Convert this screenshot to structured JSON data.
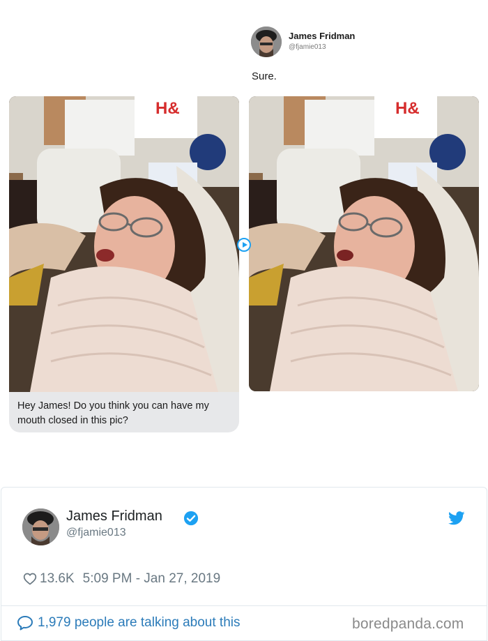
{
  "reply": {
    "name": "James Fridman",
    "handle": "@fjamie013",
    "text": "Sure."
  },
  "dm": {
    "text": "Hey James! Do you think you can have my mouth closed in this pic?"
  },
  "tweet": {
    "name": "James Fridman",
    "handle": "@fjamie013",
    "likes": "13.6K",
    "timestamp": "5:09 PM - Jan 27, 2019",
    "talking": "1,979 people are talking about this",
    "accent": "#1da1f2"
  },
  "watermark": "boredpanda.com",
  "icons": [
    "verified-icon",
    "twitter-bird-icon",
    "heart-icon",
    "comment-bubble-icon"
  ]
}
